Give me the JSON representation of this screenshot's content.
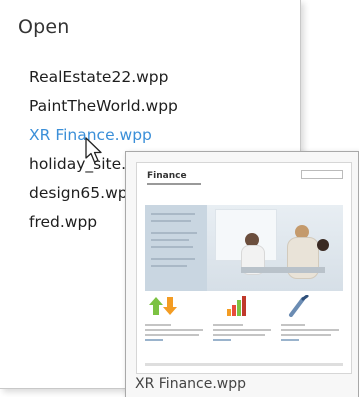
{
  "menu": {
    "title": "Open",
    "files": [
      {
        "label": "RealEstate22.wpp"
      },
      {
        "label": "PaintTheWorld.wpp"
      },
      {
        "label": "XR Finance.wpp"
      },
      {
        "label": "holiday_site."
      },
      {
        "label": "design65.wp"
      },
      {
        "label": "fred.wpp"
      }
    ],
    "hovered_index": 2
  },
  "tooltip": {
    "caption": "XR Finance.wpp",
    "preview": {
      "brand": "Finance"
    }
  },
  "colors": {
    "hover_text": "#3b8fd8",
    "text": "#1e1e1e",
    "title": "#333333"
  },
  "icons": {
    "cursor": "arrow-pointer-icon"
  }
}
